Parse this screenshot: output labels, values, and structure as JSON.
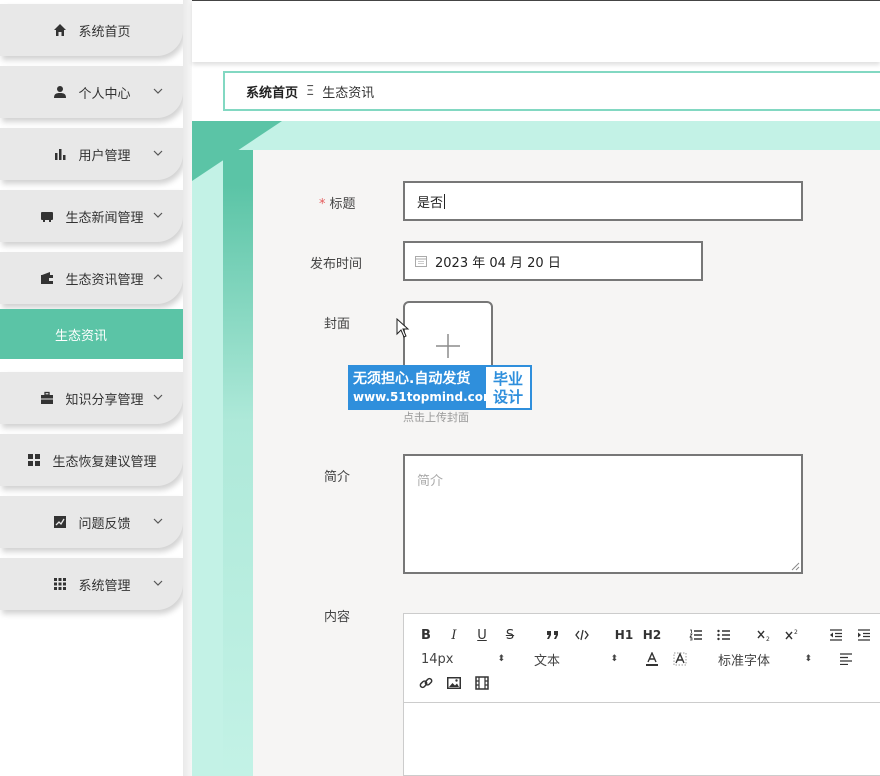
{
  "sidebar": {
    "items": [
      {
        "label": "系统首页",
        "icon": "home-icon",
        "has_chevron": false
      },
      {
        "label": "个人中心",
        "icon": "user-icon",
        "has_chevron": true
      },
      {
        "label": "用户管理",
        "icon": "bar-chart-icon",
        "has_chevron": true
      },
      {
        "label": "生态新闻管理",
        "icon": "news-icon",
        "has_chevron": true
      },
      {
        "label": "生态资讯管理",
        "icon": "wallet-icon",
        "has_chevron": true,
        "expanded": true
      },
      {
        "label": "知识分享管理",
        "icon": "briefcase-icon",
        "has_chevron": true
      },
      {
        "label": "生态恢复建议管理",
        "icon": "grid-icon",
        "has_chevron": false
      },
      {
        "label": "问题反馈",
        "icon": "trend-icon",
        "has_chevron": true
      },
      {
        "label": "系统管理",
        "icon": "apps-icon",
        "has_chevron": true
      }
    ],
    "sub_item": {
      "label": "生态资讯"
    },
    "accent_color": "#5bc4a6"
  },
  "breadcrumb": {
    "home": "系统首页",
    "separator": "Ξ",
    "current": "生态资讯"
  },
  "form": {
    "title_label": "标题",
    "required_mark": "*",
    "title_value": "是否",
    "date_label": "发布时间",
    "date_value": "2023 年 04 月 20 日",
    "cover_label": "封面",
    "upload_hint": "点击上传封面",
    "summary_label": "简介",
    "summary_placeholder": "简介",
    "content_label": "内容"
  },
  "editor": {
    "font_size": "14px",
    "paragraph": "文本",
    "font_family": "标准字体",
    "buttons": [
      "B",
      "I",
      "U",
      "S",
      "H1",
      "H2"
    ]
  },
  "watermark": {
    "line1": "无须担心.自动发货",
    "line2": "www.51topmind.com",
    "right1": "毕业",
    "right2": "设计"
  }
}
